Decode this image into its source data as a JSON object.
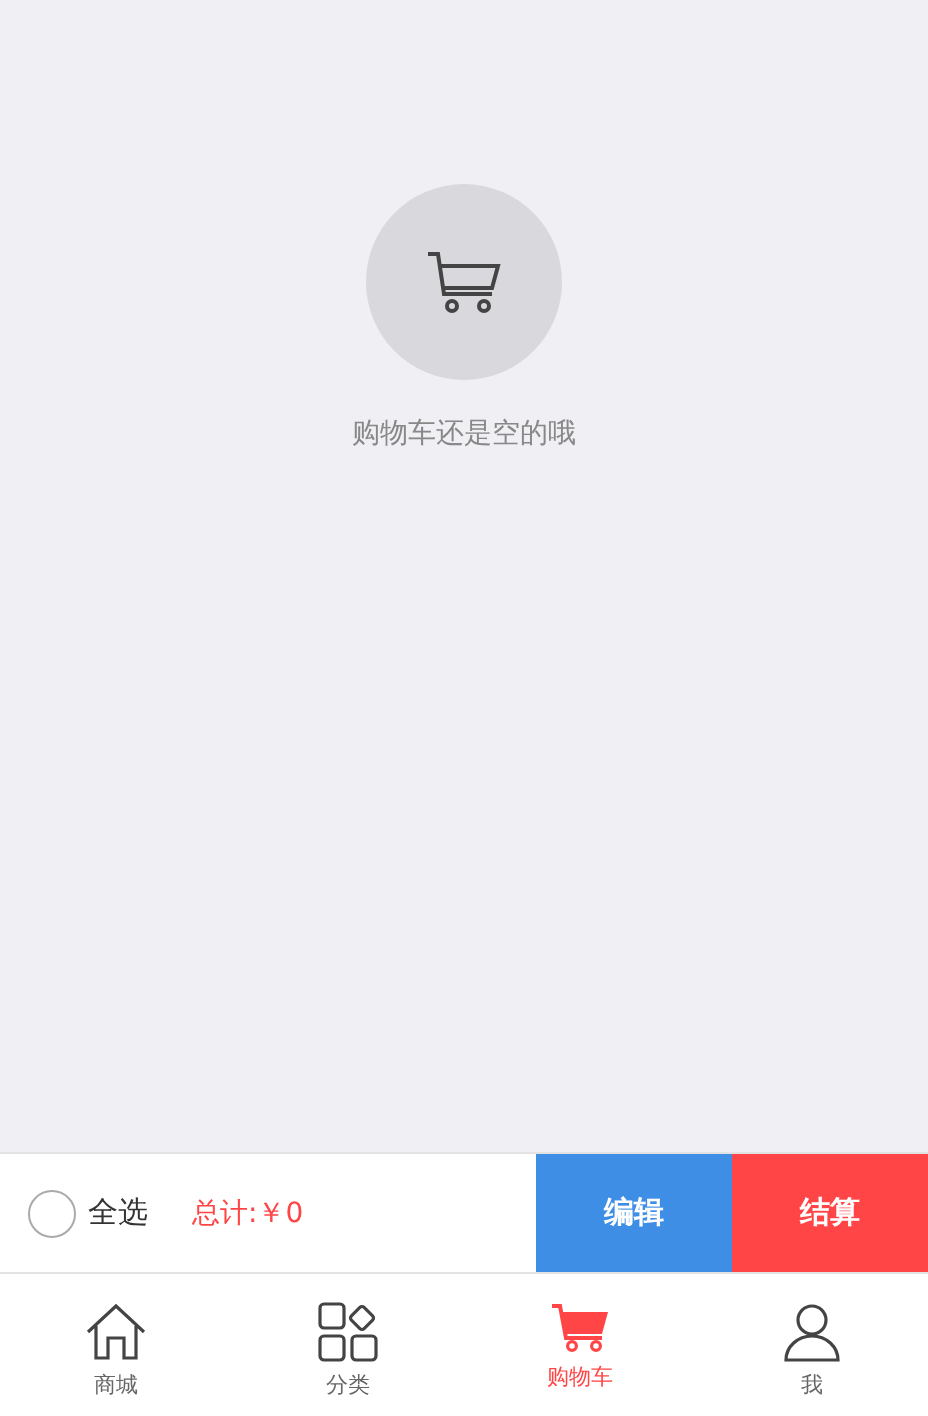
{
  "empty_state": {
    "message": "购物车还是空的哦"
  },
  "checkout_bar": {
    "select_all": {
      "label": "全选",
      "checked": false
    },
    "total": "总计:￥0",
    "buttons": [
      {
        "label": "编辑",
        "kind": "edit"
      },
      {
        "label": "结算",
        "kind": "checkout"
      }
    ]
  },
  "tab_bar": [
    {
      "label": "商城",
      "kind": "home",
      "selected": false
    },
    {
      "label": "分类",
      "kind": "category",
      "selected": false
    },
    {
      "label": "购物车",
      "kind": "cart",
      "selected": true
    },
    {
      "label": "我",
      "kind": "profile",
      "selected": false
    }
  ]
}
